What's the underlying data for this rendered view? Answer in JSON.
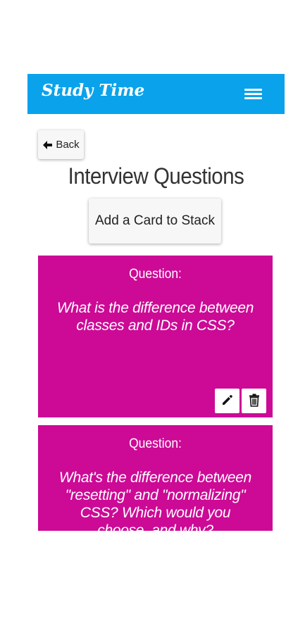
{
  "navbar": {
    "brand": "Study Time",
    "menu_icon": "hamburger-menu-icon",
    "background": "#0aa3eb"
  },
  "back_button": {
    "label": "Back",
    "icon": "arrow-left-icon"
  },
  "page_title": "Interview Questions",
  "add_card_button": {
    "label": "Add a Card to Stack"
  },
  "cards": [
    {
      "label": "Question:",
      "text": "What is the difference between classes and IDs in CSS?",
      "edit_icon": "pencil-icon",
      "delete_icon": "trash-icon"
    },
    {
      "label": "Question:",
      "text": "What's the difference between \"resetting\" and \"normalizing\" CSS? Which would you choose, and why?"
    }
  ],
  "colors": {
    "card_background": "#cc0a96",
    "button_background": "#f7f7f7",
    "title_text": "#333333"
  }
}
